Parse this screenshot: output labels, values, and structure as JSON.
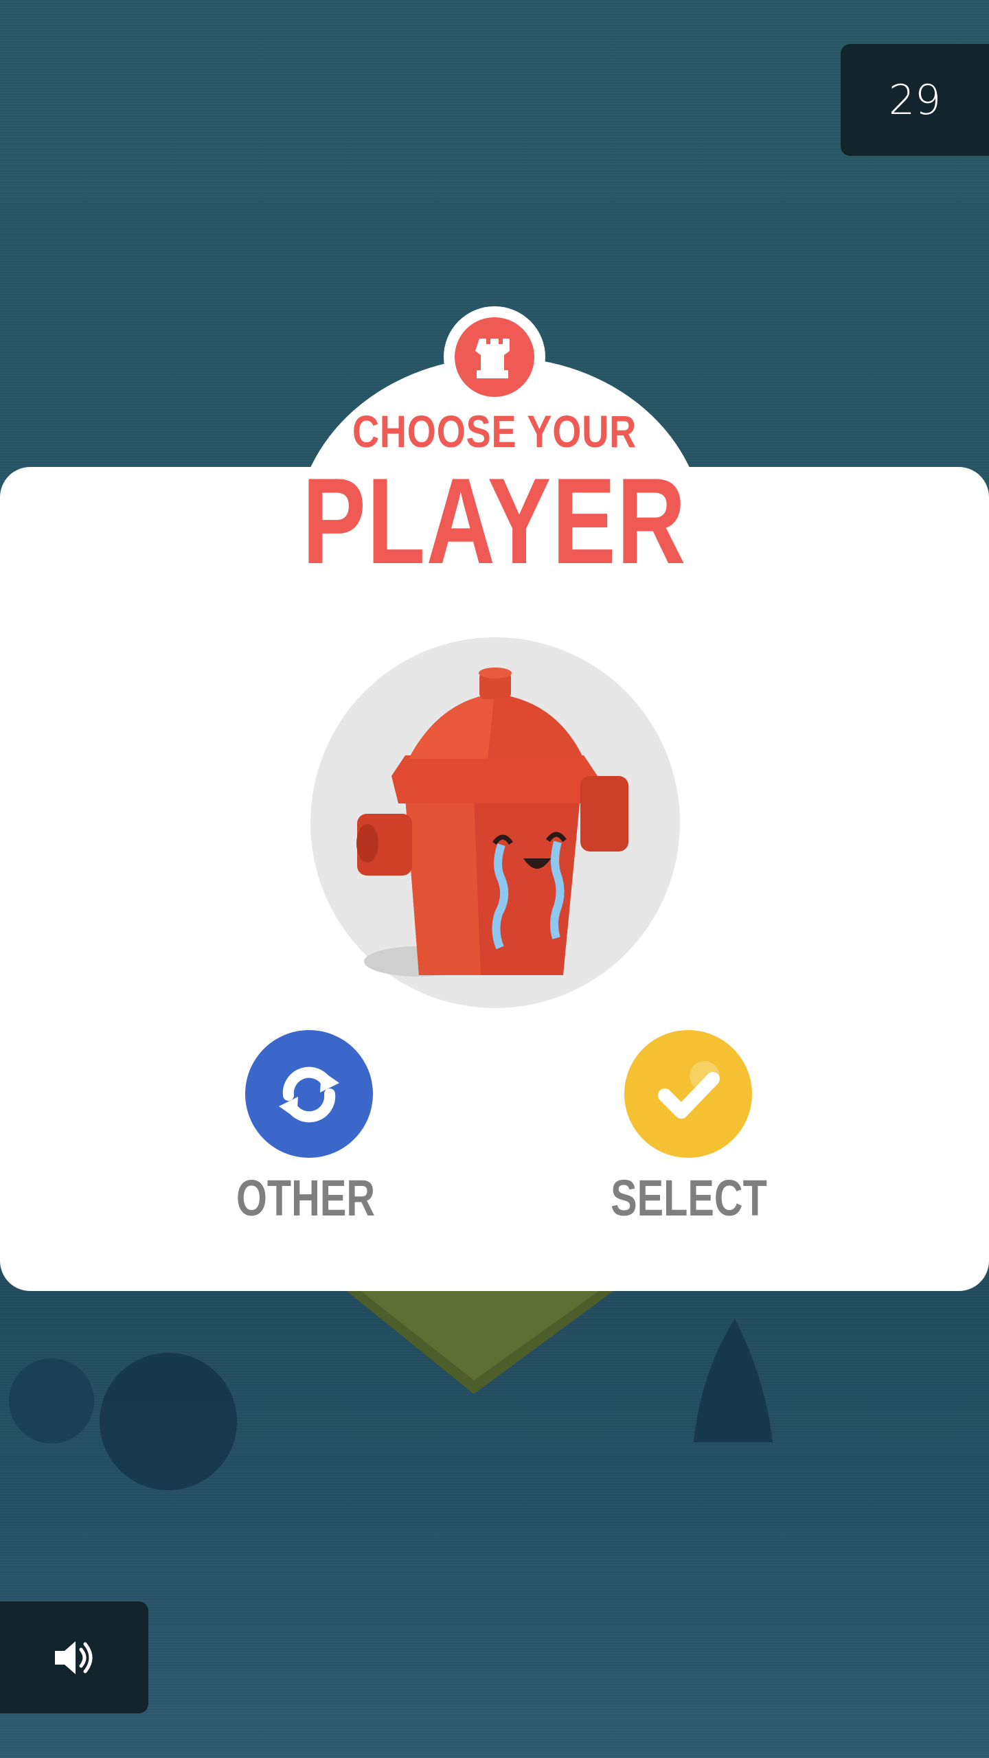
{
  "hud": {
    "score": "29",
    "sound_icon": "speaker-icon"
  },
  "dialog": {
    "badge_icon": "rook-tower-icon",
    "title_line1": "CHOOSE YOUR",
    "title_line2": "PLAYER",
    "character": "fire-hydrant-crying",
    "other_icon": "refresh-icon",
    "other_label": "OTHER",
    "select_icon": "checkmark-icon",
    "select_label": "SELECT"
  },
  "colors": {
    "accent_red": "#ef5a55",
    "other_blue": "#3a67c9",
    "select_yellow": "#f5c031",
    "background": "#245363",
    "hud_panel": "#12242c"
  }
}
